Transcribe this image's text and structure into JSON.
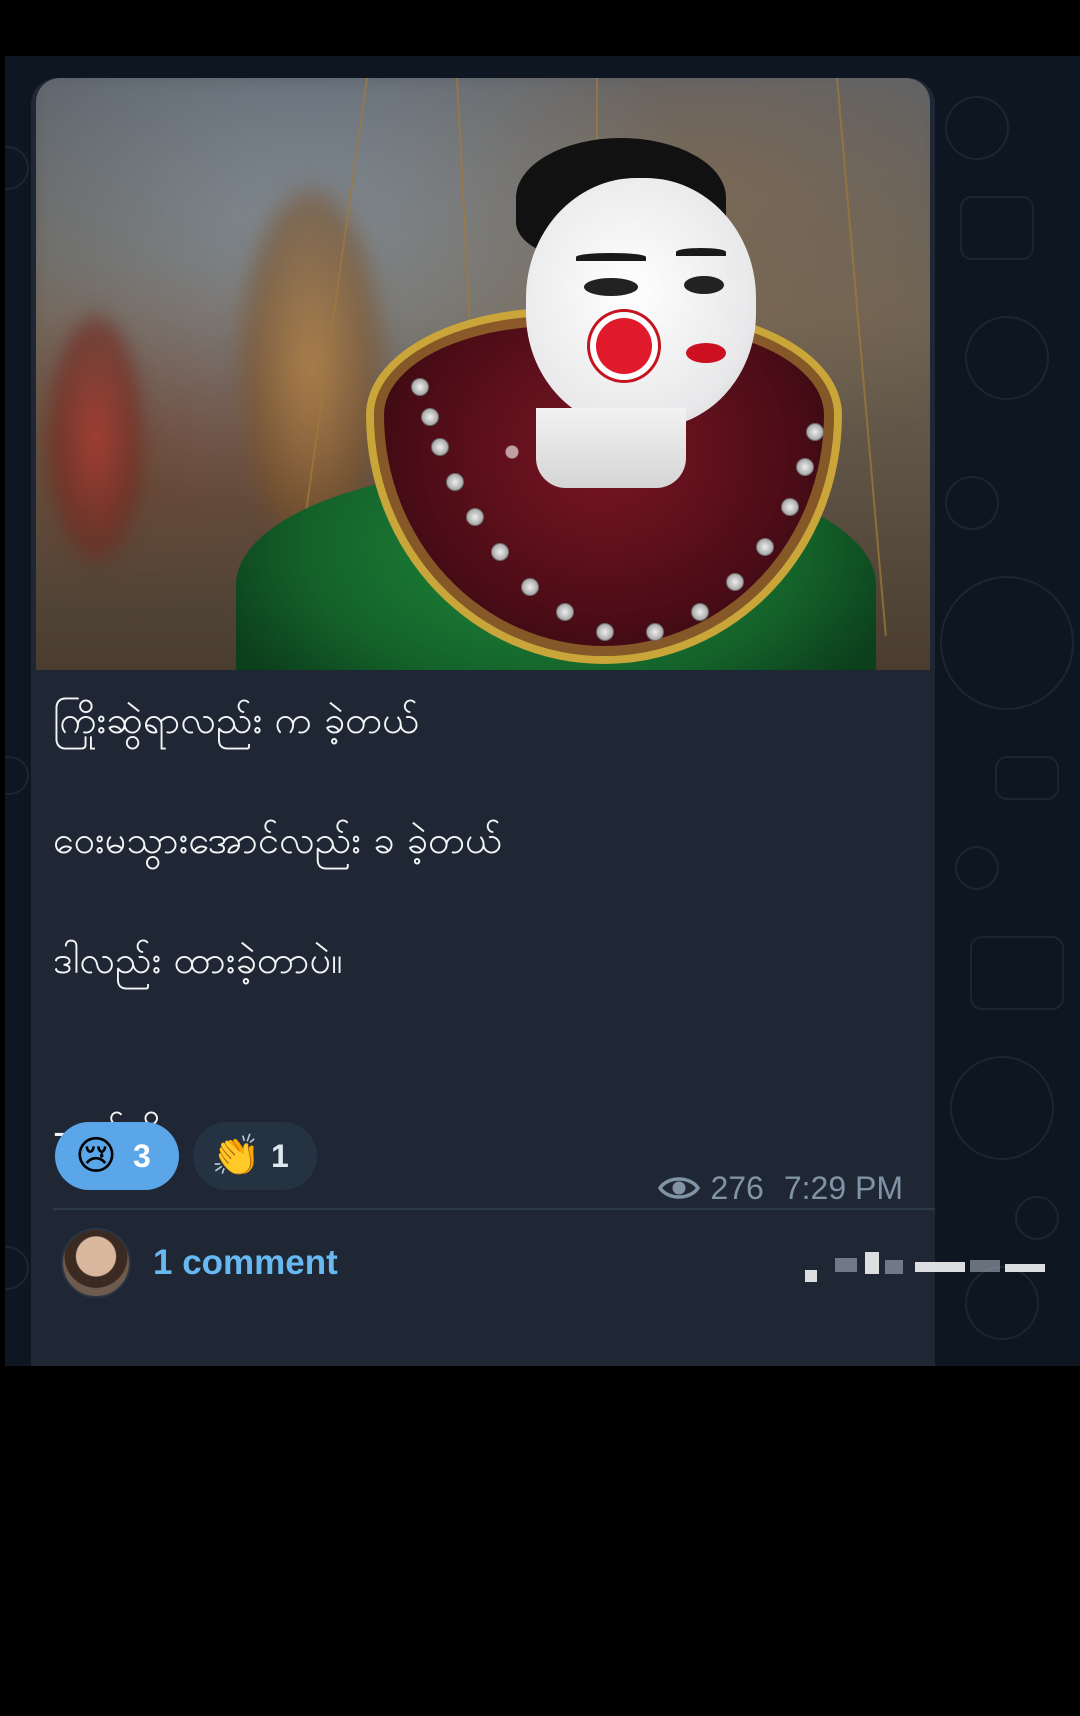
{
  "post": {
    "lines": [
      "ကြိုးဆွဲရာလည်း က ခဲ့တယ်",
      "ဝေးမသွားအောင်လည်း ခ ခဲ့တယ်",
      "ဒါလည်း ထားခဲ့တာပဲ။",
      "-မယ်ညို"
    ]
  },
  "reactions": [
    {
      "emoji": "😢",
      "icon": "crying-face-icon",
      "count": "3",
      "selected": true
    },
    {
      "emoji": "👏",
      "icon": "clapping-hands-icon",
      "count": "1",
      "selected": false
    }
  ],
  "meta": {
    "views": "276",
    "time": "7:29 PM"
  },
  "comments": {
    "label": "1 comment"
  },
  "colors": {
    "chat_background": "#0e1621",
    "bubble_background": "#1e2733",
    "reaction_selected": "#5aa6e8",
    "reaction_unselected": "#243242",
    "comment_link": "#68b8f2",
    "meta_text": "#8193a5"
  }
}
